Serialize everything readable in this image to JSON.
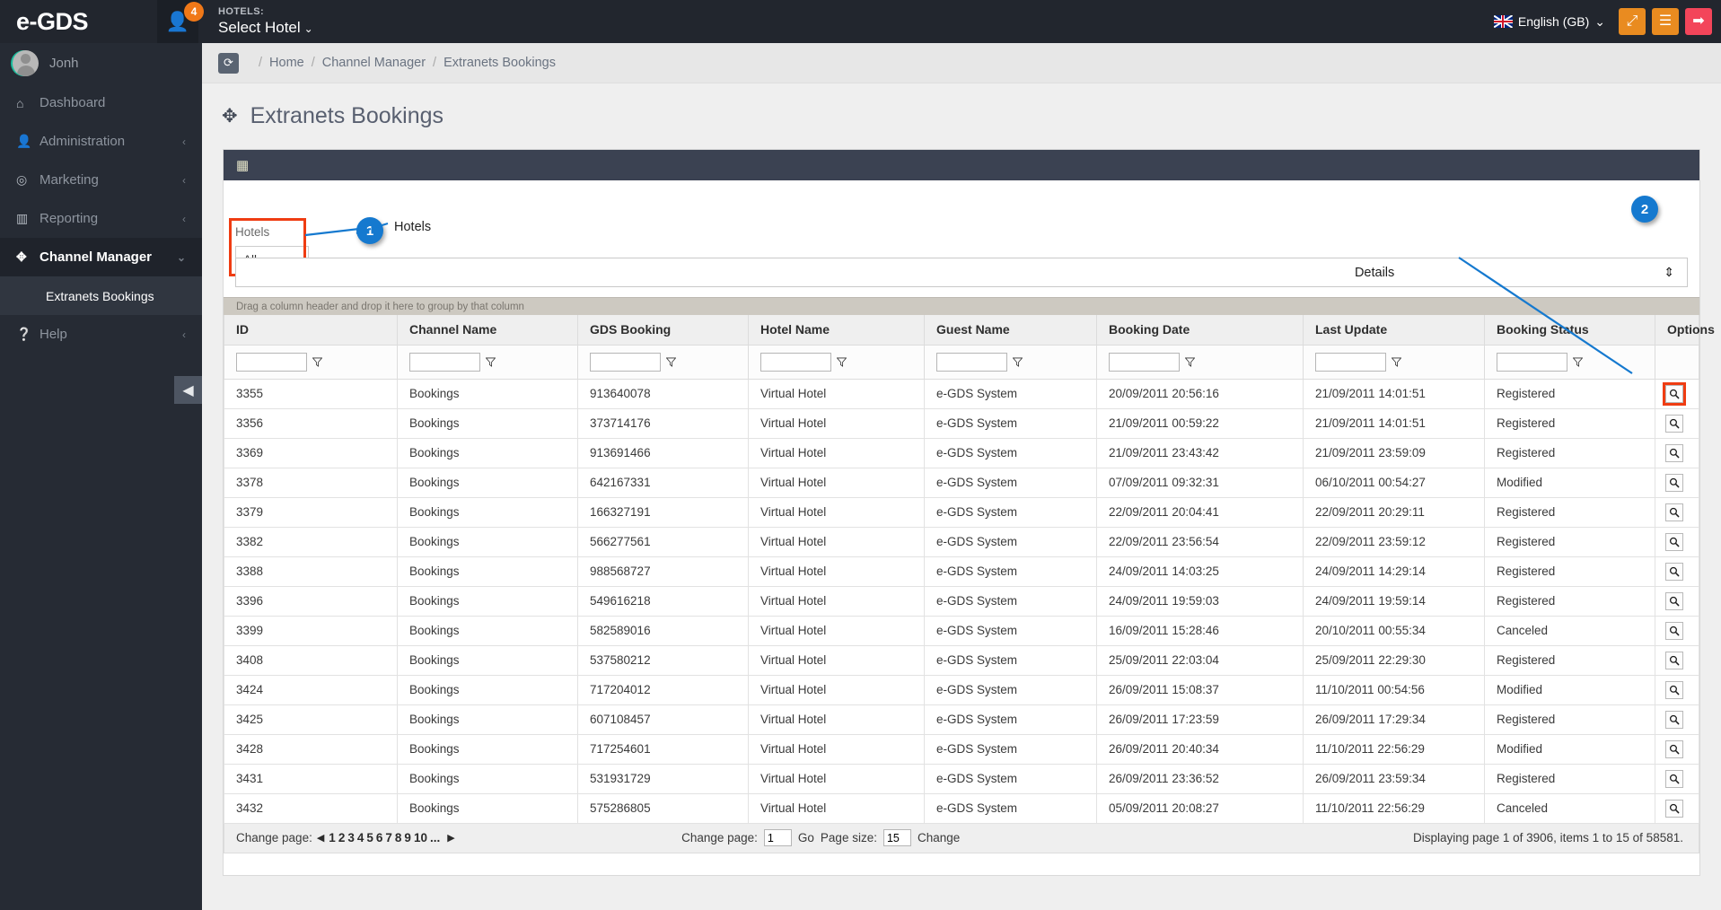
{
  "topbar": {
    "brand": "e-GDS",
    "user_badge": "4",
    "hotels_kicker": "HOTELS:",
    "hotels_value": "Select Hotel",
    "hotels_caret": "⌄",
    "language": "English (GB)",
    "language_caret": "⌄",
    "buttons": [
      {
        "name": "fullscreen-button",
        "glyph": "⤢"
      },
      {
        "name": "menu-button",
        "glyph": "☰"
      },
      {
        "name": "logout-button",
        "glyph": "➡"
      }
    ]
  },
  "sidebar": {
    "username": "Jonh",
    "items": [
      {
        "label": "Dashboard",
        "icon": "⌂",
        "chevron": "",
        "active": false
      },
      {
        "label": "Administration",
        "icon": "👤",
        "chevron": "‹",
        "active": false
      },
      {
        "label": "Marketing",
        "icon": "◎",
        "chevron": "‹",
        "active": false
      },
      {
        "label": "Reporting",
        "icon": "▥",
        "chevron": "‹",
        "active": false
      },
      {
        "label": "Channel Manager",
        "icon": "✥",
        "chevron": "⌄",
        "active": true
      }
    ],
    "subitem": "Extranets Bookings",
    "help": {
      "label": "Help",
      "icon": "?",
      "chevron": "‹"
    },
    "collapse_glyph": "◀"
  },
  "breadcrumb": {
    "refresh_icon": "⟳",
    "leading_sep": "/",
    "items": [
      "Home",
      "Channel Manager",
      "Extranets Bookings"
    ]
  },
  "page": {
    "title": "Extranets Bookings",
    "title_icon": "✥"
  },
  "panel": {
    "grid_icon": "▦",
    "filter": {
      "hotels_label": "Hotels",
      "hotels_value": "All",
      "hotels_annotation": "Hotels",
      "details_label": "Details",
      "details_spinner": "⇕"
    },
    "group_hint": "Drag a column header and drop it here to group by that column",
    "callouts": [
      "1",
      "2"
    ]
  },
  "table": {
    "columns": [
      "ID",
      "Channel Name",
      "GDS Booking",
      "Hotel Name",
      "Guest Name",
      "Booking Date",
      "Last Update",
      "Booking Status",
      "Options"
    ],
    "filter_values": [
      "",
      "",
      "",
      "",
      "",
      "",
      "",
      ""
    ],
    "options_icon": "🔍",
    "rows": [
      {
        "id": "3355",
        "channel": "Bookings",
        "gds": "913640078",
        "hotel": "Virtual Hotel",
        "guest": "e-GDS System",
        "booking_date": "20/09/2011 20:56:16",
        "last_update": "21/09/2011 14:01:51",
        "status": "Registered",
        "highlight": true
      },
      {
        "id": "3356",
        "channel": "Bookings",
        "gds": "373714176",
        "hotel": "Virtual Hotel",
        "guest": "e-GDS System",
        "booking_date": "21/09/2011 00:59:22",
        "last_update": "21/09/2011 14:01:51",
        "status": "Registered",
        "highlight": false
      },
      {
        "id": "3369",
        "channel": "Bookings",
        "gds": "913691466",
        "hotel": "Virtual Hotel",
        "guest": "e-GDS System",
        "booking_date": "21/09/2011 23:43:42",
        "last_update": "21/09/2011 23:59:09",
        "status": "Registered",
        "highlight": false
      },
      {
        "id": "3378",
        "channel": "Bookings",
        "gds": "642167331",
        "hotel": "Virtual Hotel",
        "guest": "e-GDS System",
        "booking_date": "07/09/2011 09:32:31",
        "last_update": "06/10/2011 00:54:27",
        "status": "Modified",
        "highlight": false
      },
      {
        "id": "3379",
        "channel": "Bookings",
        "gds": "166327191",
        "hotel": "Virtual Hotel",
        "guest": "e-GDS System",
        "booking_date": "22/09/2011 20:04:41",
        "last_update": "22/09/2011 20:29:11",
        "status": "Registered",
        "highlight": false
      },
      {
        "id": "3382",
        "channel": "Bookings",
        "gds": "566277561",
        "hotel": "Virtual Hotel",
        "guest": "e-GDS System",
        "booking_date": "22/09/2011 23:56:54",
        "last_update": "22/09/2011 23:59:12",
        "status": "Registered",
        "highlight": false
      },
      {
        "id": "3388",
        "channel": "Bookings",
        "gds": "988568727",
        "hotel": "Virtual Hotel",
        "guest": "e-GDS System",
        "booking_date": "24/09/2011 14:03:25",
        "last_update": "24/09/2011 14:29:14",
        "status": "Registered",
        "highlight": false
      },
      {
        "id": "3396",
        "channel": "Bookings",
        "gds": "549616218",
        "hotel": "Virtual Hotel",
        "guest": "e-GDS System",
        "booking_date": "24/09/2011 19:59:03",
        "last_update": "24/09/2011 19:59:14",
        "status": "Registered",
        "highlight": false
      },
      {
        "id": "3399",
        "channel": "Bookings",
        "gds": "582589016",
        "hotel": "Virtual Hotel",
        "guest": "e-GDS System",
        "booking_date": "16/09/2011 15:28:46",
        "last_update": "20/10/2011 00:55:34",
        "status": "Canceled",
        "highlight": false
      },
      {
        "id": "3408",
        "channel": "Bookings",
        "gds": "537580212",
        "hotel": "Virtual Hotel",
        "guest": "e-GDS System",
        "booking_date": "25/09/2011 22:03:04",
        "last_update": "25/09/2011 22:29:30",
        "status": "Registered",
        "highlight": false
      },
      {
        "id": "3424",
        "channel": "Bookings",
        "gds": "717204012",
        "hotel": "Virtual Hotel",
        "guest": "e-GDS System",
        "booking_date": "26/09/2011 15:08:37",
        "last_update": "11/10/2011 00:54:56",
        "status": "Modified",
        "highlight": false
      },
      {
        "id": "3425",
        "channel": "Bookings",
        "gds": "607108457",
        "hotel": "Virtual Hotel",
        "guest": "e-GDS System",
        "booking_date": "26/09/2011 17:23:59",
        "last_update": "26/09/2011 17:29:34",
        "status": "Registered",
        "highlight": false
      },
      {
        "id": "3428",
        "channel": "Bookings",
        "gds": "717254601",
        "hotel": "Virtual Hotel",
        "guest": "e-GDS System",
        "booking_date": "26/09/2011 20:40:34",
        "last_update": "11/10/2011 22:56:29",
        "status": "Modified",
        "highlight": false
      },
      {
        "id": "3431",
        "channel": "Bookings",
        "gds": "531931729",
        "hotel": "Virtual Hotel",
        "guest": "e-GDS System",
        "booking_date": "26/09/2011 23:36:52",
        "last_update": "26/09/2011 23:59:34",
        "status": "Registered",
        "highlight": false
      },
      {
        "id": "3432",
        "channel": "Bookings",
        "gds": "575286805",
        "hotel": "Virtual Hotel",
        "guest": "e-GDS System",
        "booking_date": "05/09/2011 20:08:27",
        "last_update": "11/10/2011 22:56:29",
        "status": "Canceled",
        "highlight": false
      }
    ]
  },
  "footer": {
    "change_page_label": "Change page:",
    "prev_arrow": "◀",
    "next_arrow": "▶",
    "pages": [
      "1",
      "2",
      "3",
      "4",
      "5",
      "6",
      "7",
      "8",
      "9",
      "10",
      "..."
    ],
    "change_page_label_2": "Change page:",
    "page_value": "1",
    "go_label": "Go",
    "page_size_label": "Page size:",
    "page_size_value": "15",
    "change_label": "Change",
    "status": "Displaying page 1 of 3906, items 1 to 15 of 58581."
  },
  "colors": {
    "accent_orange": "#e98b20",
    "accent_red": "#f3455a",
    "callout_blue": "#1579cf",
    "highlight_red": "#ef3c12",
    "sidebar_bg": "#262b34",
    "topbar_bg": "#22262e"
  }
}
